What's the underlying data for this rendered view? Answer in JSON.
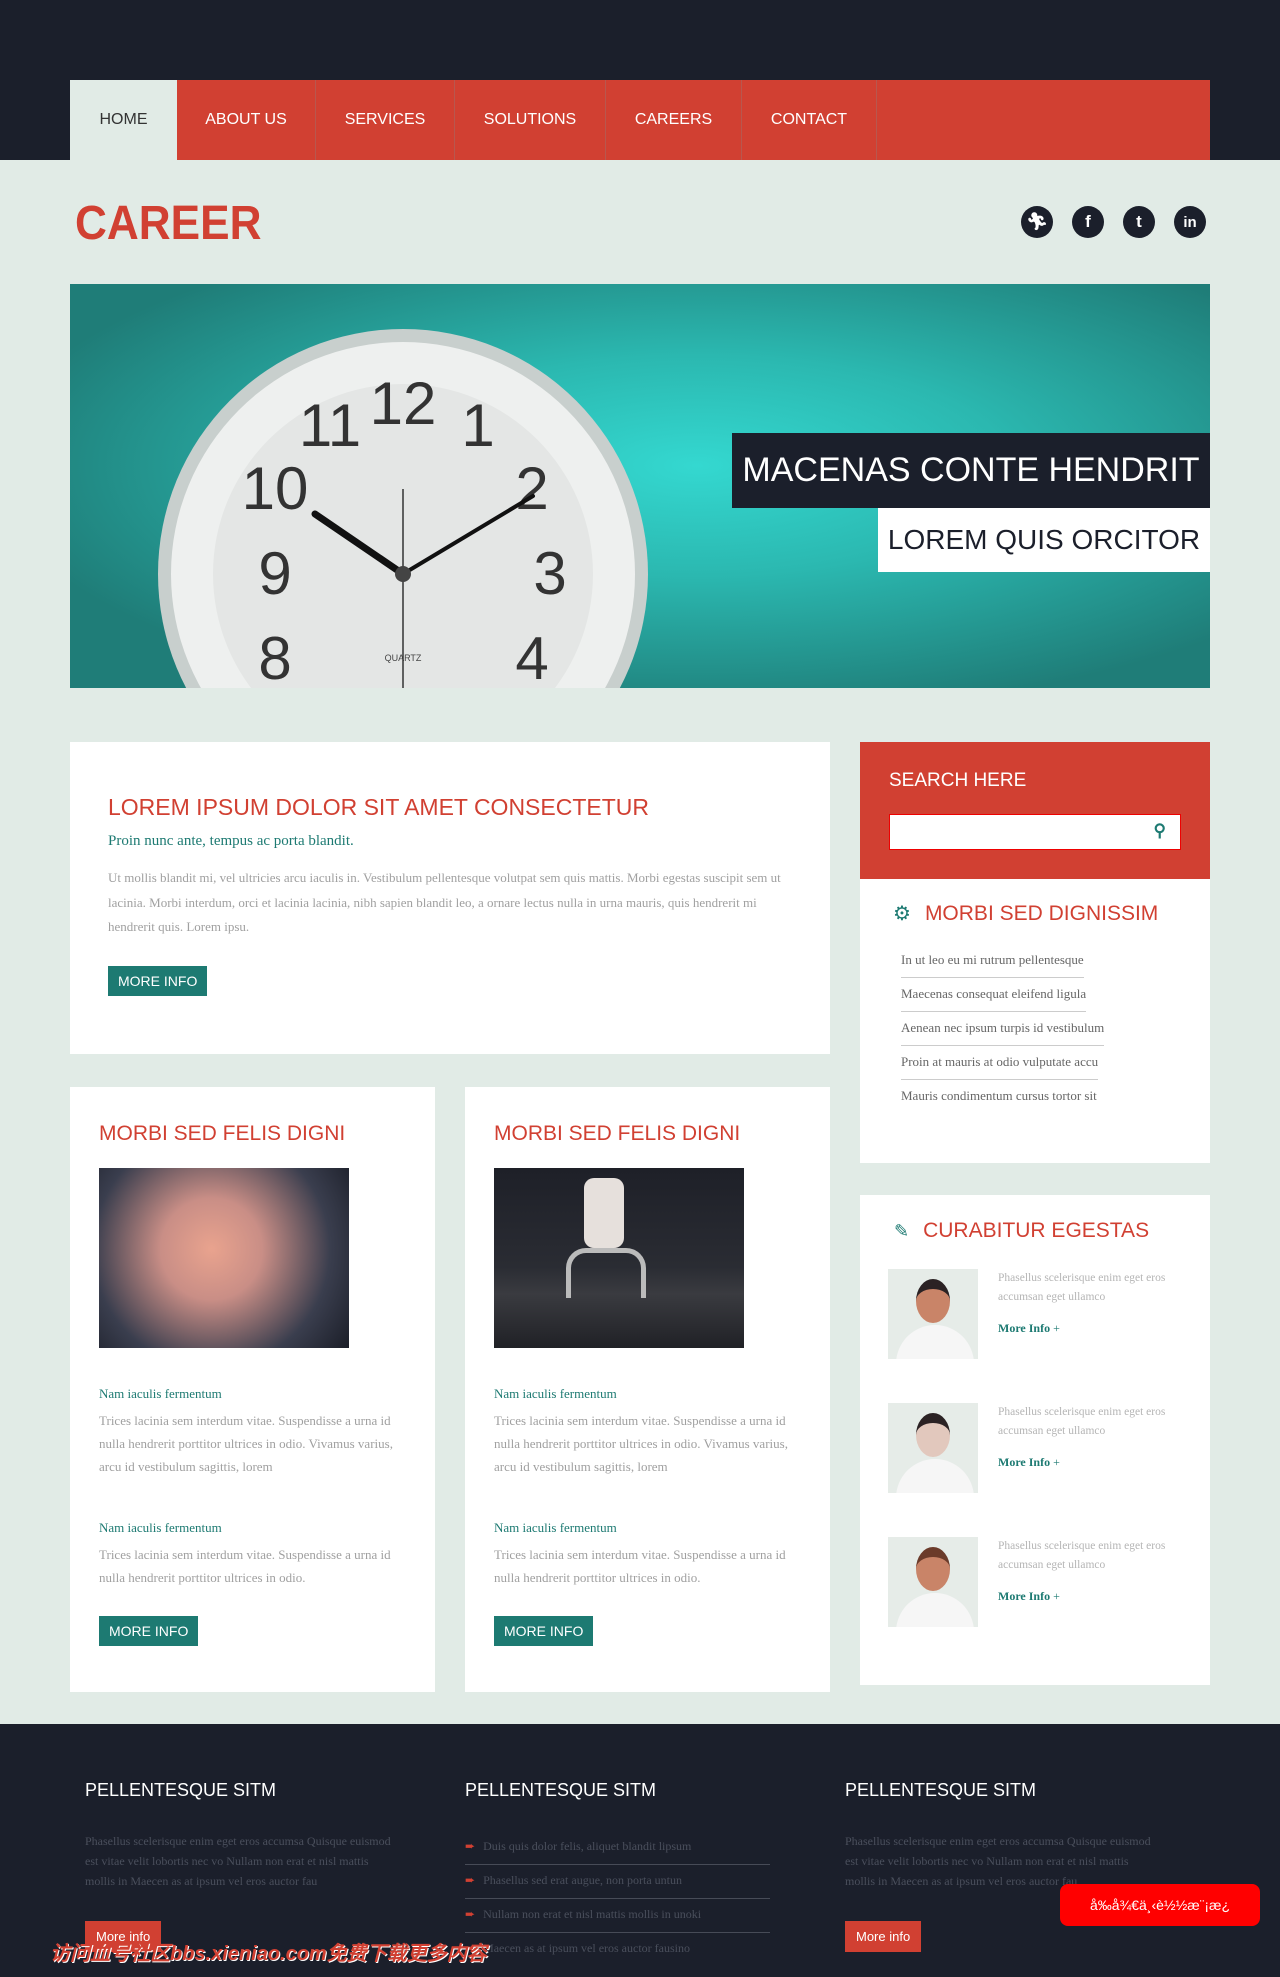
{
  "nav": {
    "items": [
      {
        "label": "HOME",
        "active": true
      },
      {
        "label": "ABOUT US"
      },
      {
        "label": "SERVICES"
      },
      {
        "label": "SOLUTIONS"
      },
      {
        "label": "CAREERS"
      },
      {
        "label": "CONTACT"
      }
    ]
  },
  "header": {
    "logo": "CAREER",
    "social": [
      "runner-icon",
      "facebook-icon",
      "twitter-icon",
      "linkedin-icon"
    ]
  },
  "banner": {
    "caption1": "MACENAS CONTE HENDRIT",
    "caption2": "LOREM QUIS ORCITOR",
    "clock_label": "QUARTZ"
  },
  "intro": {
    "title": "LOREM IPSUM DOLOR SIT AMET CONSECTETUR",
    "subtitle": "Proin nunc ante, tempus ac porta blandit.",
    "body": "Ut mollis blandit mi, vel ultricies arcu iaculis in. Vestibulum pellentesque volutpat sem quis mattis. Morbi egestas suscipit sem ut lacinia. Morbi interdum, orci et lacinia lacinia, nibh sapien blandit leo, a ornare lectus nulla in urna mauris, quis hendrerit mi hendrerit quis. Lorem ipsu.",
    "button": "MORE INFO"
  },
  "cards": [
    {
      "title": "MORBI SED FELIS DIGNI",
      "s1_title": "Nam iaculis fermentum",
      "s1_body": "Trices lacinia sem interdum vitae. Suspendisse a urna id nulla hendrerit porttitor ultrices in odio. Vivamus varius, arcu id vestibulum sagittis, lorem",
      "s2_title": "Nam iaculis fermentum",
      "s2_body": "Trices lacinia sem interdum vitae. Suspendisse a urna id nulla hendrerit porttitor ultrices in odio.",
      "button": "MORE INFO"
    },
    {
      "title": "MORBI SED FELIS DIGNI",
      "s1_title": "Nam iaculis fermentum",
      "s1_body": "Trices lacinia sem interdum vitae. Suspendisse a urna id nulla hendrerit porttitor ultrices in odio. Vivamus varius, arcu id vestibulum sagittis, lorem",
      "s2_title": "Nam iaculis fermentum",
      "s2_body": "Trices lacinia sem interdum vitae. Suspendisse a urna id nulla hendrerit porttitor ultrices in odio.",
      "button": "MORE INFO"
    }
  ],
  "search": {
    "title": "SEARCH HERE",
    "placeholder": ""
  },
  "dignissim": {
    "title": "MORBI SED DIGNISSIM",
    "items": [
      "In ut leo eu mi rutrum pellentesque",
      "Maecenas consequat eleifend ligula",
      "Aenean nec ipsum turpis id vestibulum",
      "Proin at mauris at odio vulputate accu",
      "Mauris condimentum cursus tortor sit"
    ]
  },
  "curabitur": {
    "title": "CURABITUR EGESTAS",
    "people": [
      {
        "text": "Phasellus scelerisque enim eget eros accumsan eget ullamco",
        "link": "More Info",
        "plus": "+"
      },
      {
        "text": "Phasellus scelerisque enim eget eros accumsan eget ullamco",
        "link": "More Info",
        "plus": "+"
      },
      {
        "text": "Phasellus scelerisque enim eget eros accumsan eget ullamco",
        "link": "More Info",
        "plus": "+"
      }
    ]
  },
  "footer": {
    "col1": {
      "title": "PELLENTESQUE SITM",
      "text": "Phasellus scelerisque enim eget eros accumsa Quisque euismod est vitae velit lobortis nec vo Nullam non erat et nisl mattis mollis in Maecen as at ipsum vel eros auctor fau",
      "button": "More info"
    },
    "col2": {
      "title": "PELLENTESQUE SITM",
      "items": [
        "Duis quis dolor felis, aliquet blandit lipsum",
        "Phasellus sed erat augue, non porta untun",
        "Nullam non erat et nisl mattis mollis in unoki",
        "Maecen as at ipsum vel eros auctor fausino"
      ]
    },
    "col3": {
      "title": "PELLENTESQUE SITM",
      "text": "Phasellus scelerisque enim eget eros accumsa Quisque euismod est vitae velit lobortis nec vo Nullam non erat et nisl mattis mollis in Maecen as at ipsum vel eros auctor fau",
      "button": "More info"
    }
  },
  "badge": "å‰å¾€ä¸‹è½½æ¨¡æ¿",
  "watermark": "访问血号社区bbs.xieniao.com免费下载更多内容",
  "colors": {
    "accent": "#d14032",
    "teal": "#1d7a72",
    "dark": "#1b1f2b",
    "bg": "#e1ebe6"
  }
}
